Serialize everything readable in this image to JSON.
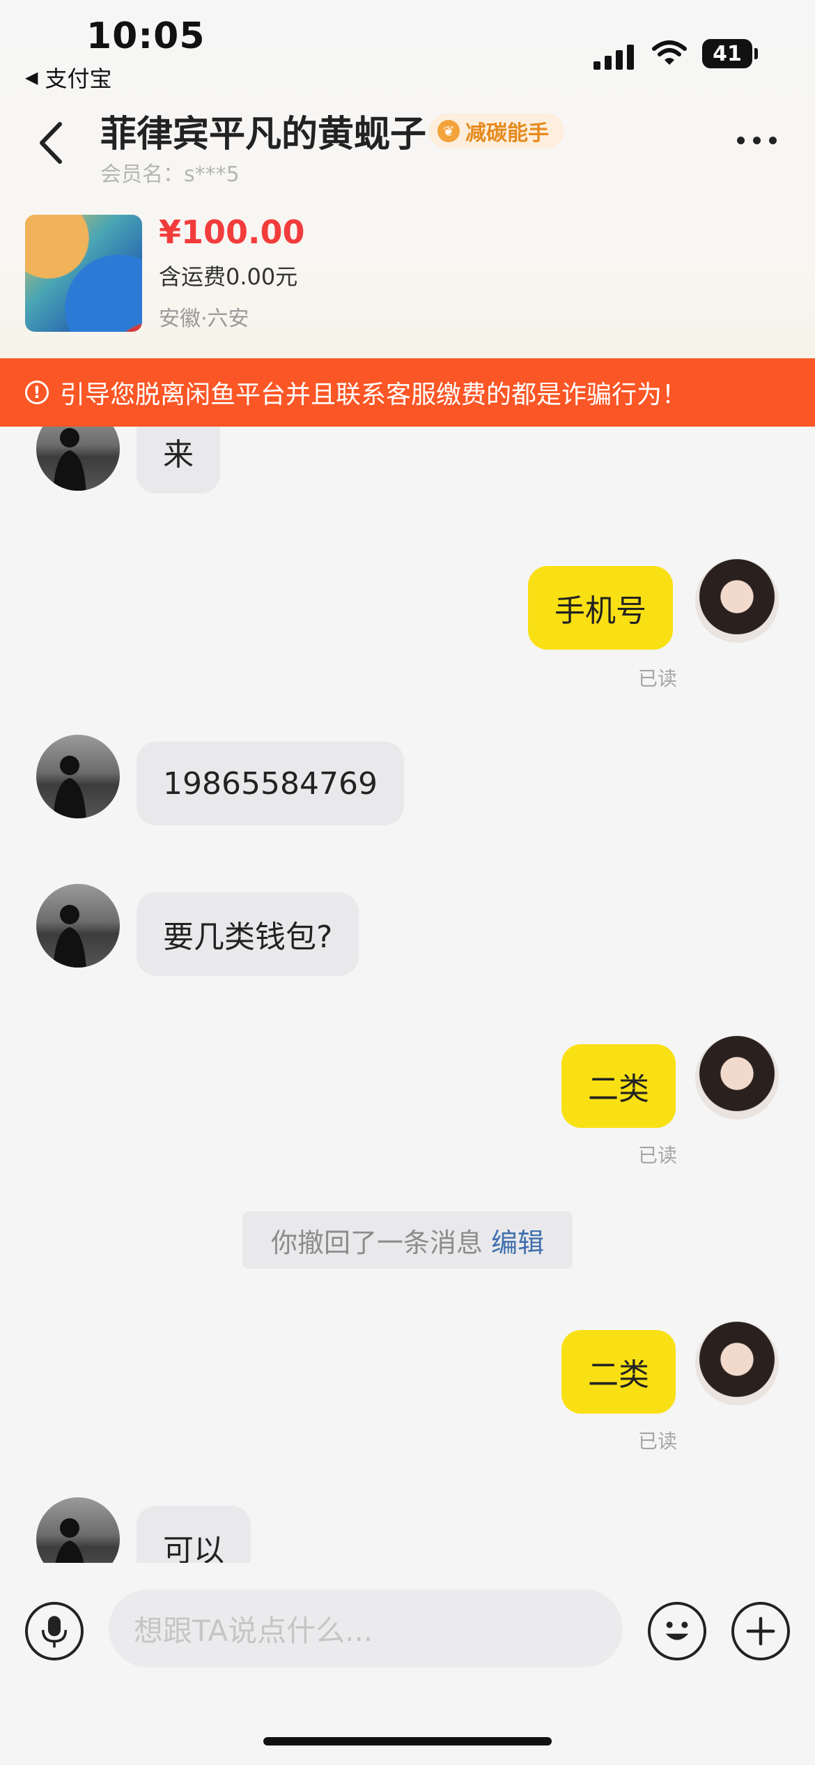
{
  "status_bar": {
    "time": "10:05",
    "back_app": "支付宝",
    "battery": "41"
  },
  "header": {
    "title": "菲律宾平凡的黄蚬子",
    "badge": "减碳能手",
    "member": "会员名：s***5"
  },
  "product": {
    "price": "¥100.00",
    "shipping": "含运费0.00元",
    "location": "安徽·六安"
  },
  "warning": {
    "text": "引导您脱离闲鱼平台并且联系客服缴费的都是诈骗行为！"
  },
  "messages": [
    {
      "side": "other",
      "text": "来"
    },
    {
      "side": "me",
      "text": "手机号",
      "status": "已读"
    },
    {
      "side": "other",
      "text": "19865584769"
    },
    {
      "side": "other",
      "text": "要几类钱包?"
    },
    {
      "side": "me",
      "text": "二类",
      "status": "已读"
    },
    {
      "side": "me",
      "text": "二类",
      "status": "已读"
    },
    {
      "side": "other",
      "text": "可以"
    }
  ],
  "system_message": {
    "text": "你撤回了一条消息",
    "action": "编辑"
  },
  "input": {
    "placeholder": "想跟TA说点什么..."
  },
  "icons": {
    "mic": "microphone-icon",
    "emoji": "emoji-icon",
    "plus": "plus-icon",
    "back": "chevron-left-icon",
    "more": "more-dots-icon"
  }
}
